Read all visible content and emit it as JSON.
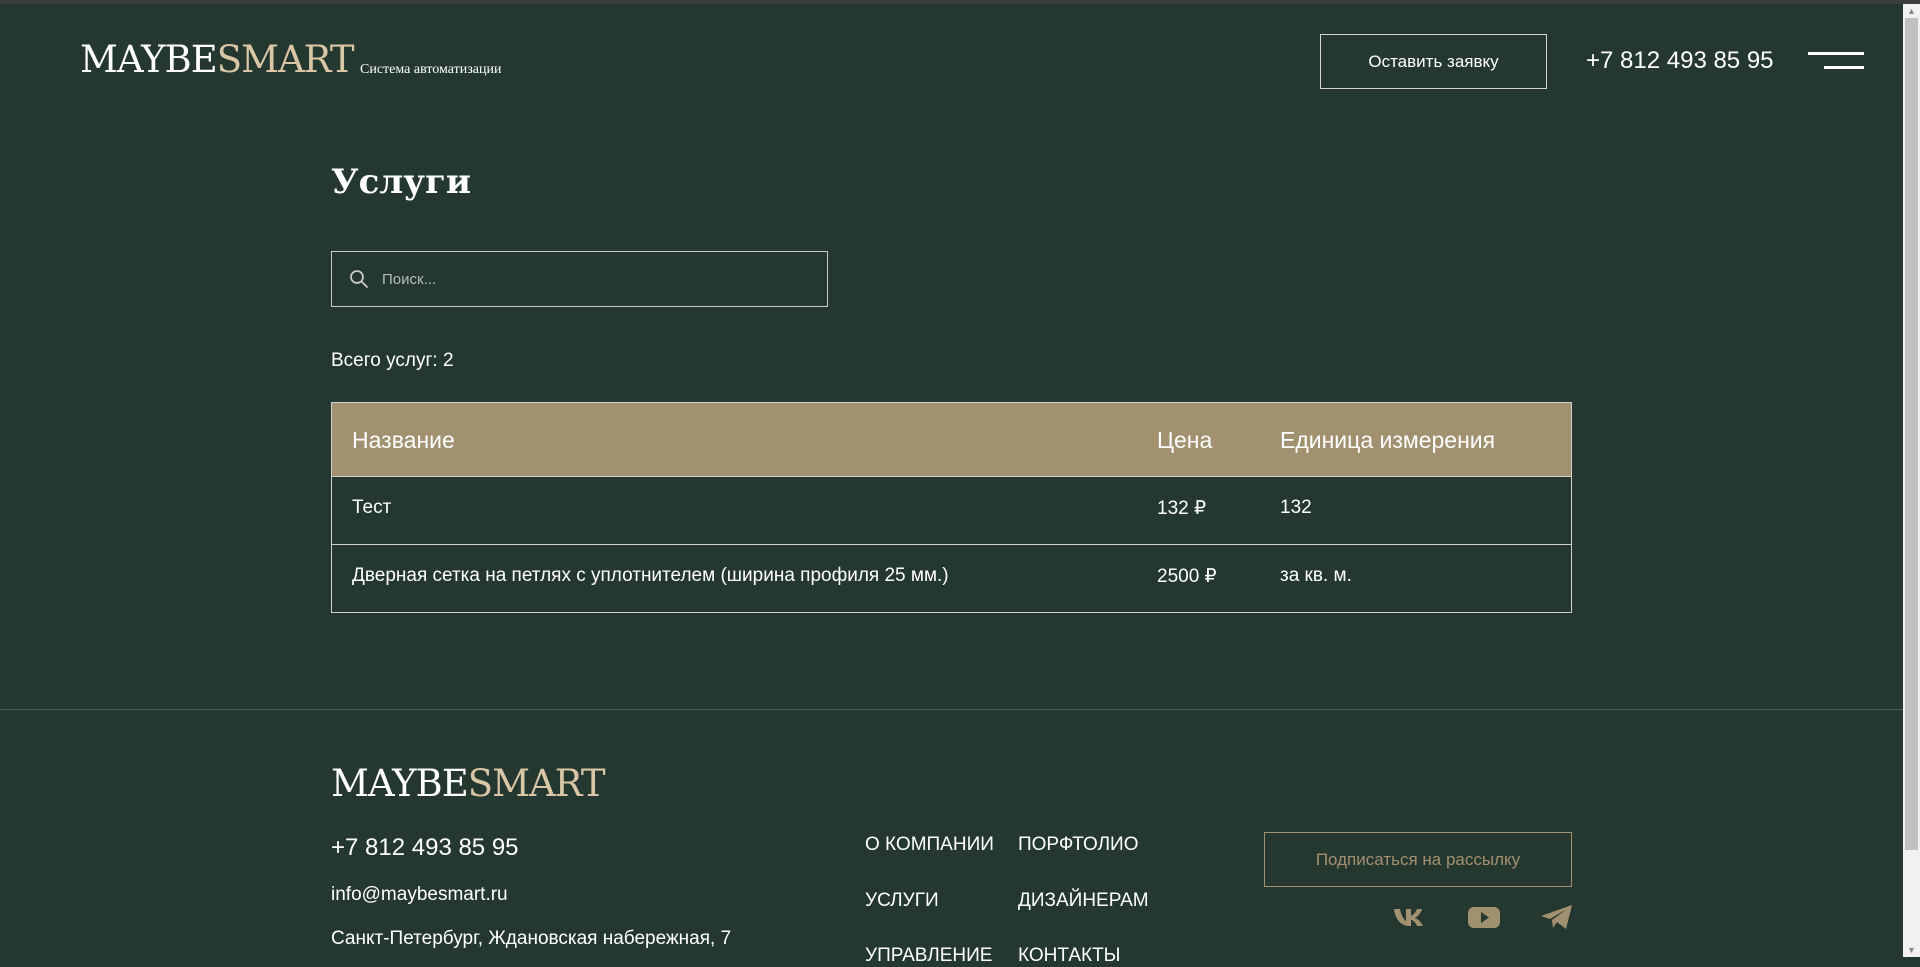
{
  "header": {
    "logo_part1": "MAYBE",
    "logo_part2": "SMART",
    "tagline": "Система автоматизации",
    "cta_label": "Оставить заявку",
    "phone": "+7 812 493 85 95",
    "menu_icon": "hamburger-menu-icon"
  },
  "main": {
    "title": "Услуги",
    "search": {
      "placeholder": "Поиск...",
      "value": "",
      "icon": "search-icon"
    },
    "count_text": "Всего услуг: 2",
    "table": {
      "columns": [
        "Название",
        "Цена",
        "Единица измерения"
      ],
      "rows": [
        [
          "Тест",
          "132 ₽",
          "132"
        ],
        [
          "Дверная сетка на петлях с уплотнителем (ширина профиля 25 мм.)",
          "2500 ₽",
          "за кв. м."
        ]
      ]
    }
  },
  "footer": {
    "logo_part1": "MAYBE",
    "logo_part2": "SMART",
    "phone": "+7 812 493 85 95",
    "email": "info@maybesmart.ru",
    "address": "Санкт-Петербург, Ждановская набережная, 7",
    "nav": [
      "О КОМПАНИИ",
      "ПОРФТОЛИО",
      "УСЛУГИ",
      "ДИЗАЙНЕРАМ",
      "УПРАВЛЕНИЕ",
      "КОНТАКТЫ"
    ],
    "subscribe_label": "Подписаться на рассылку",
    "social_icons": [
      "vk-icon",
      "youtube-icon",
      "telegram-icon"
    ]
  },
  "colors": {
    "background": "#243830",
    "accent": "#a29170",
    "logo_accent": "#d9c6a7",
    "text": "#ffffff"
  }
}
